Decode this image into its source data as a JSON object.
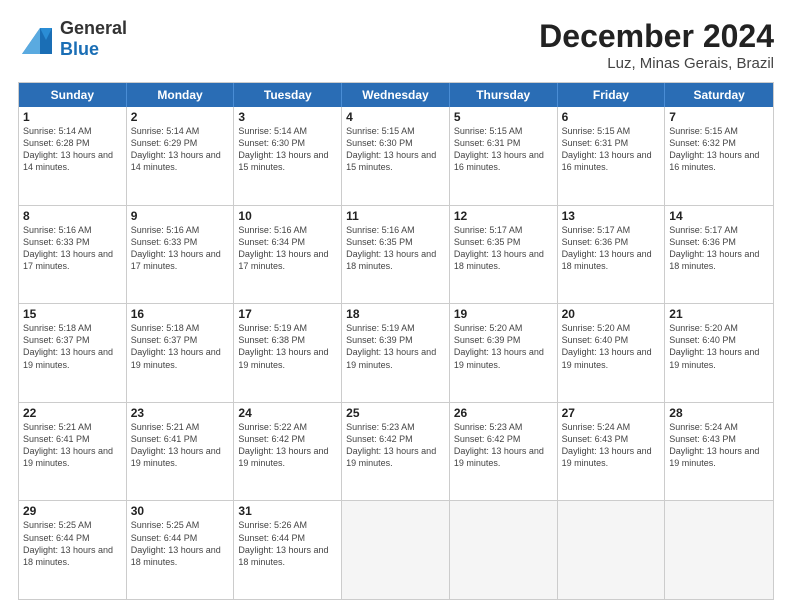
{
  "header": {
    "logo_general": "General",
    "logo_blue": "Blue",
    "month": "December 2024",
    "location": "Luz, Minas Gerais, Brazil"
  },
  "days": [
    "Sunday",
    "Monday",
    "Tuesday",
    "Wednesday",
    "Thursday",
    "Friday",
    "Saturday"
  ],
  "weeks": [
    [
      {
        "day": 1,
        "sunrise": "5:14 AM",
        "sunset": "6:28 PM",
        "daylight": "13 hours and 14 minutes."
      },
      {
        "day": 2,
        "sunrise": "5:14 AM",
        "sunset": "6:29 PM",
        "daylight": "13 hours and 14 minutes."
      },
      {
        "day": 3,
        "sunrise": "5:14 AM",
        "sunset": "6:30 PM",
        "daylight": "13 hours and 15 minutes."
      },
      {
        "day": 4,
        "sunrise": "5:15 AM",
        "sunset": "6:30 PM",
        "daylight": "13 hours and 15 minutes."
      },
      {
        "day": 5,
        "sunrise": "5:15 AM",
        "sunset": "6:31 PM",
        "daylight": "13 hours and 16 minutes."
      },
      {
        "day": 6,
        "sunrise": "5:15 AM",
        "sunset": "6:31 PM",
        "daylight": "13 hours and 16 minutes."
      },
      {
        "day": 7,
        "sunrise": "5:15 AM",
        "sunset": "6:32 PM",
        "daylight": "13 hours and 16 minutes."
      }
    ],
    [
      {
        "day": 8,
        "sunrise": "5:16 AM",
        "sunset": "6:33 PM",
        "daylight": "13 hours and 17 minutes."
      },
      {
        "day": 9,
        "sunrise": "5:16 AM",
        "sunset": "6:33 PM",
        "daylight": "13 hours and 17 minutes."
      },
      {
        "day": 10,
        "sunrise": "5:16 AM",
        "sunset": "6:34 PM",
        "daylight": "13 hours and 17 minutes."
      },
      {
        "day": 11,
        "sunrise": "5:16 AM",
        "sunset": "6:35 PM",
        "daylight": "13 hours and 18 minutes."
      },
      {
        "day": 12,
        "sunrise": "5:17 AM",
        "sunset": "6:35 PM",
        "daylight": "13 hours and 18 minutes."
      },
      {
        "day": 13,
        "sunrise": "5:17 AM",
        "sunset": "6:36 PM",
        "daylight": "13 hours and 18 minutes."
      },
      {
        "day": 14,
        "sunrise": "5:17 AM",
        "sunset": "6:36 PM",
        "daylight": "13 hours and 18 minutes."
      }
    ],
    [
      {
        "day": 15,
        "sunrise": "5:18 AM",
        "sunset": "6:37 PM",
        "daylight": "13 hours and 19 minutes."
      },
      {
        "day": 16,
        "sunrise": "5:18 AM",
        "sunset": "6:37 PM",
        "daylight": "13 hours and 19 minutes."
      },
      {
        "day": 17,
        "sunrise": "5:19 AM",
        "sunset": "6:38 PM",
        "daylight": "13 hours and 19 minutes."
      },
      {
        "day": 18,
        "sunrise": "5:19 AM",
        "sunset": "6:39 PM",
        "daylight": "13 hours and 19 minutes."
      },
      {
        "day": 19,
        "sunrise": "5:20 AM",
        "sunset": "6:39 PM",
        "daylight": "13 hours and 19 minutes."
      },
      {
        "day": 20,
        "sunrise": "5:20 AM",
        "sunset": "6:40 PM",
        "daylight": "13 hours and 19 minutes."
      },
      {
        "day": 21,
        "sunrise": "5:20 AM",
        "sunset": "6:40 PM",
        "daylight": "13 hours and 19 minutes."
      }
    ],
    [
      {
        "day": 22,
        "sunrise": "5:21 AM",
        "sunset": "6:41 PM",
        "daylight": "13 hours and 19 minutes."
      },
      {
        "day": 23,
        "sunrise": "5:21 AM",
        "sunset": "6:41 PM",
        "daylight": "13 hours and 19 minutes."
      },
      {
        "day": 24,
        "sunrise": "5:22 AM",
        "sunset": "6:42 PM",
        "daylight": "13 hours and 19 minutes."
      },
      {
        "day": 25,
        "sunrise": "5:23 AM",
        "sunset": "6:42 PM",
        "daylight": "13 hours and 19 minutes."
      },
      {
        "day": 26,
        "sunrise": "5:23 AM",
        "sunset": "6:42 PM",
        "daylight": "13 hours and 19 minutes."
      },
      {
        "day": 27,
        "sunrise": "5:24 AM",
        "sunset": "6:43 PM",
        "daylight": "13 hours and 19 minutes."
      },
      {
        "day": 28,
        "sunrise": "5:24 AM",
        "sunset": "6:43 PM",
        "daylight": "13 hours and 19 minutes."
      }
    ],
    [
      {
        "day": 29,
        "sunrise": "5:25 AM",
        "sunset": "6:44 PM",
        "daylight": "13 hours and 18 minutes."
      },
      {
        "day": 30,
        "sunrise": "5:25 AM",
        "sunset": "6:44 PM",
        "daylight": "13 hours and 18 minutes."
      },
      {
        "day": 31,
        "sunrise": "5:26 AM",
        "sunset": "6:44 PM",
        "daylight": "13 hours and 18 minutes."
      },
      null,
      null,
      null,
      null
    ]
  ]
}
